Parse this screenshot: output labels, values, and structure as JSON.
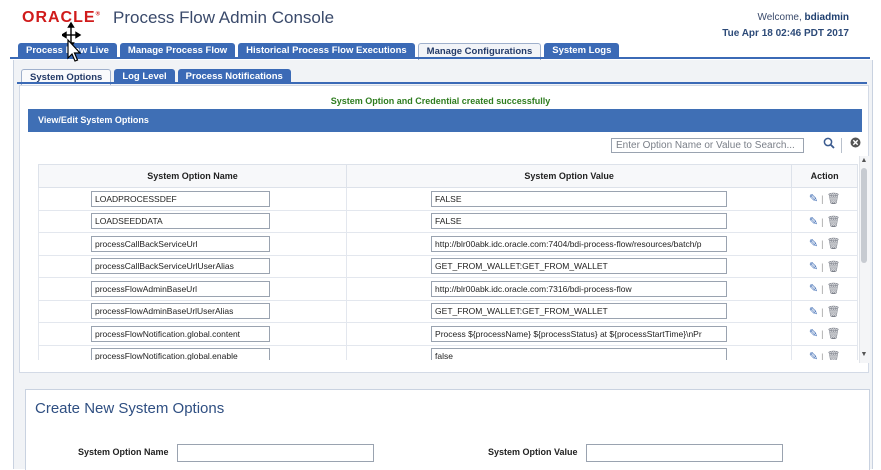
{
  "header": {
    "logo": "ORACLE",
    "title": "Process Flow Admin Console",
    "welcome_prefix": "Welcome, ",
    "username": "bdiadmin",
    "datetime": "Tue Apr 18 02:46 PDT 2017"
  },
  "main_tabs": [
    {
      "label": "Process Flow Live"
    },
    {
      "label": "Manage Process Flow"
    },
    {
      "label": "Historical Process Flow Executions"
    },
    {
      "label": "Manage Configurations"
    },
    {
      "label": "System Logs"
    }
  ],
  "sub_tabs": [
    {
      "label": "System Options"
    },
    {
      "label": "Log Level"
    },
    {
      "label": "Process Notifications"
    }
  ],
  "message": "System Option and Credential created successfully",
  "panel": {
    "title": "View/Edit System Options",
    "search_placeholder": "Enter Option Name or Value to Search..."
  },
  "table": {
    "columns": [
      "System Option Name",
      "System Option Value",
      "Action"
    ],
    "rows": [
      {
        "name": "LOADPROCESSDEF",
        "value": "FALSE"
      },
      {
        "name": "LOADSEEDDATA",
        "value": "FALSE"
      },
      {
        "name": "processCallBackServiceUrl",
        "value": "http://blr00abk.idc.oracle.com:7404/bdi-process-flow/resources/batch/p"
      },
      {
        "name": "processCallBackServiceUrlUserAlias",
        "value": "GET_FROM_WALLET:GET_FROM_WALLET"
      },
      {
        "name": "processFlowAdminBaseUrl",
        "value": "http://blr00abk.idc.oracle.com:7316/bdi-process-flow"
      },
      {
        "name": "processFlowAdminBaseUrlUserAlias",
        "value": "GET_FROM_WALLET:GET_FROM_WALLET"
      },
      {
        "name": "processFlowNotification.global.content",
        "value": "Process ${processName} ${processStatus} at ${processStartTime}\\nPr"
      },
      {
        "name": "processFlowNotification.global.enable",
        "value": "false"
      }
    ]
  },
  "create": {
    "title": "Create New System Options",
    "name_label": "System Option Name",
    "value_label": "System Option Value"
  },
  "icons": {
    "edit": "edit-pencil-icon",
    "delete": "trash-icon",
    "search": "search-icon",
    "clear": "clear-icon"
  },
  "colors": {
    "tab_blue": "#3b6ab6",
    "panel_header": "#3f6fb5",
    "success_green": "#2e7d1f",
    "oracle_red": "#d01b1b"
  }
}
